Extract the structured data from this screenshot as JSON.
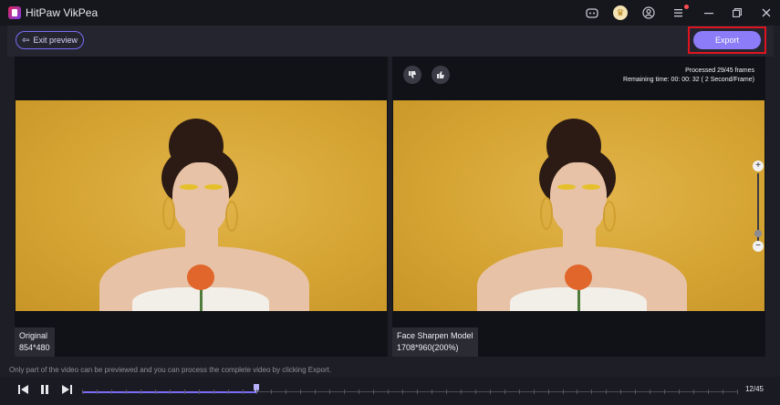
{
  "app": {
    "title": "HitPaw VikPea"
  },
  "titlebar_icons": [
    "discord-icon",
    "gift-icon",
    "account-icon",
    "menu-icon",
    "minimize-icon",
    "restore-icon",
    "close-icon"
  ],
  "toolbar": {
    "exit_label": "Exit preview",
    "export_label": "Export"
  },
  "left_panel": {
    "label": "Original",
    "resolution": "854*480"
  },
  "right_panel": {
    "label": "Face Sharpen Model",
    "resolution": "1708*960(200%)",
    "processed": "Processed 29/45 frames",
    "remaining": "Remaining time: 00: 00: 32 ( 2 Second/Frame)"
  },
  "info_text": "Only part of the video can be previewed and you can process the complete video by clicking Export.",
  "playback": {
    "frame_label": "12/45",
    "current_frame": 12,
    "total_frames": 45
  },
  "colors": {
    "accent": "#8c7cf8",
    "highlight_border": "#e0141e",
    "background": "#1d1e26"
  }
}
